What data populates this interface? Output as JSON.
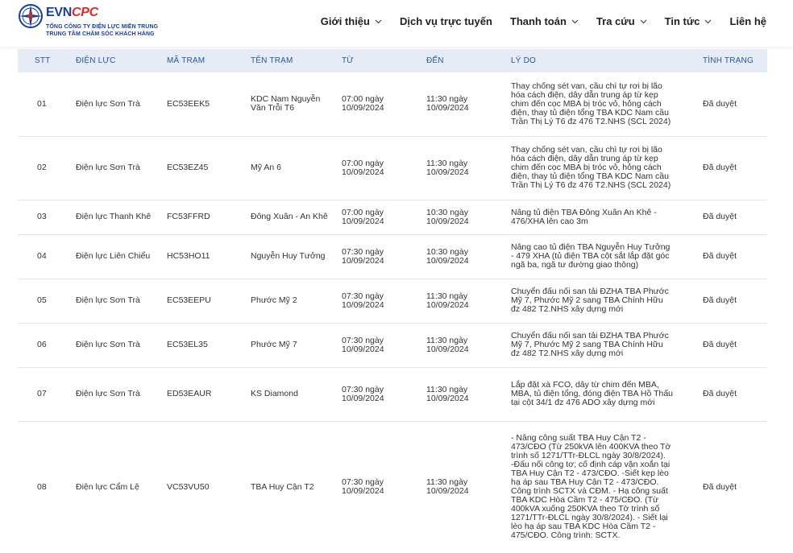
{
  "header": {
    "brand_evn": "EVN",
    "brand_cpc": "CPC",
    "sub1": "TỔNG CÔNG TY ĐIỆN LỰC MIỀN TRUNG",
    "sub2": "TRUNG TÂM CHĂM SÓC KHÁCH HÀNG"
  },
  "nav": {
    "items": [
      {
        "label": "Giới thiệu"
      },
      {
        "label": "Dịch vụ trực tuyến"
      },
      {
        "label": "Thanh toán"
      },
      {
        "label": "Tra cứu"
      },
      {
        "label": "Tin tức"
      },
      {
        "label": "Liên hệ"
      }
    ]
  },
  "table": {
    "headers": [
      "STT",
      "ĐIỆN LỰC",
      "MÃ TRẠM",
      "TÊN TRẠM",
      "TỪ",
      "ĐẾN",
      "LÝ DO",
      "TÌNH TRẠNG"
    ],
    "rows": [
      {
        "stt": "01",
        "dien_luc": "Điện lực Sơn Trà",
        "ma_tram": "EC53EEK5",
        "ten_tram": "KDC Nam Nguyễn Văn Trỗi T6",
        "tu": "07:00 ngày 10/09/2024",
        "den": "11:30 ngày 10/09/2024",
        "ly_do": "Thay chống sét van, cầu chì tự rơi bị lão hóa cách điện, dây dẫn trung áp từ kẹp chim đến cọc MBA bị tróc vỏ, hỏng cách điện, thay tủ điện tổng TBA KDC Nam cầu Trần Thị Lý T6 đz 476 T2.NHS (SCL 2024)",
        "tinh_trang": "Đã duyệt"
      },
      {
        "stt": "02",
        "dien_luc": "Điện lực Sơn Trà",
        "ma_tram": "EC53EZ45",
        "ten_tram": "Mỹ An 6",
        "tu": "07:00 ngày 10/09/2024",
        "den": "11:30 ngày 10/09/2024",
        "ly_do": "Thay chống sét van, cầu chì tự rơi bị lão hóa cách điện, dây dẫn trung áp từ kẹp chim đến cọc MBA bị tróc vỏ, hỏng cách điện, thay tủ điện tổng TBA KDC Nam cầu Trần Thị Lý T6 đz 476 T2.NHS (SCL 2024)",
        "tinh_trang": "Đã duyệt"
      },
      {
        "stt": "03",
        "dien_luc": "Điện lực Thanh Khê",
        "ma_tram": "FC53FFRD",
        "ten_tram": "Đông Xuân - An Khê",
        "tu": "07:00 ngày 10/09/2024",
        "den": "10:30 ngày 10/09/2024",
        "ly_do": "Nâng tủ điện TBA Đông Xuân An Khê - 476/XHA lên cao 3m",
        "tinh_trang": "Đã duyệt"
      },
      {
        "stt": "04",
        "dien_luc": "Điện lực Liên Chiểu",
        "ma_tram": "HC53HO11",
        "ten_tram": "Nguyễn Huy Tưởng",
        "tu": "07:30 ngày 10/09/2024",
        "den": "10:30 ngày 10/09/2024",
        "ly_do": "Nâng cao tủ điện TBA Nguyễn Huy Tưởng - 479 XHA (tủ điện TBA cột sắt lắp đặt góc ngã ba, ngã tư đường giao thông)",
        "tinh_trang": "Đã duyệt"
      },
      {
        "stt": "05",
        "dien_luc": "Điện lực Sơn Trà",
        "ma_tram": "EC53EEPU",
        "ten_tram": "Phước Mỹ 2",
        "tu": "07:30 ngày 10/09/2024",
        "den": "11:30 ngày 10/09/2024",
        "ly_do": "Chuyển đấu nối san tải ĐZHA TBA Phước Mỹ 7, Phước Mỹ 2 sang TBA Chính Hữu đz 482 T2.NHS xây dựng mới",
        "tinh_trang": "Đã duyệt"
      },
      {
        "stt": "06",
        "dien_luc": "Điện lực Sơn Trà",
        "ma_tram": "EC53EL35",
        "ten_tram": "Phước Mỹ 7",
        "tu": "07:30 ngày 10/09/2024",
        "den": "11:30 ngày 10/09/2024",
        "ly_do": "Chuyển đấu nối san tải ĐZHA TBA Phước Mỹ 7, Phước Mỹ 2 sang TBA Chính Hữu đz 482 T2.NHS xây dựng mới",
        "tinh_trang": "Đã duyệt"
      },
      {
        "stt": "07",
        "dien_luc": "Điện lực Sơn Trà",
        "ma_tram": "ED53EAUR",
        "ten_tram": "KS Diamond",
        "tu": "07:30 ngày 10/09/2024",
        "den": "11:30 ngày 10/09/2024",
        "ly_do": "Lắp đặt xà FCO, dây từ chim đến MBA, MBA, tủ điện tổng, đóng điện TBA Hồ Thấu tại cột 34/1 đz 476 ADO xây dựng mới",
        "tinh_trang": "Đã duyệt"
      },
      {
        "stt": "08",
        "dien_luc": "Điện lực Cẩm Lệ",
        "ma_tram": "VC53VU50",
        "ten_tram": "TBA Huy Cận T2",
        "tu": "07:30 ngày 10/09/2024",
        "den": "11:30 ngày 10/09/2024",
        "ly_do": "- Nâng công suất TBA Huy Cận T2 - 473/CĐO (Từ 250kVA lên 400KVA theo Tờ trình số 1271/TTr-ĐLCL ngày 30/8/2024). -Đấu nối công tơ; cố định cáp vặn xoắn tại TBA Huy Cận T2 - 473/CĐO. -Siết kẹp lèo hạ áp sau TBA Huy Cận T2 - 473/CĐO. Công trình SCTX và CĐM. - Hạ công suất TBA KDC Hòa Cầm T2 - 475/CĐO. (Từ 400kVA xuống 250KVA theo Tờ trình số 1271/TTr-ĐLCL ngày 30/8/2024). - Siết lại lèo hạ áp sau TBA KDC Hòa Cầm T2 - 475/CĐO. Công trình: SCTX.",
        "tinh_trang": "Đã duyệt"
      }
    ]
  }
}
